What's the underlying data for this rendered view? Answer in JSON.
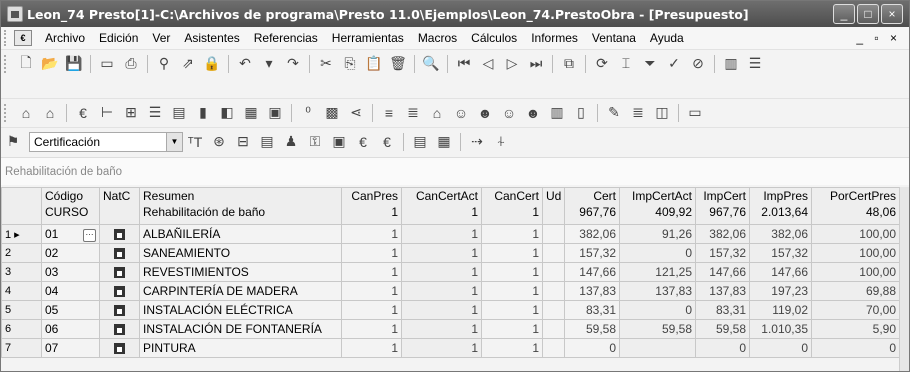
{
  "window": {
    "title": "Leon_74 Presto[1]-C:\\Archivos de programa\\Presto 11.0\\Ejemplos\\Leon_74.PrestoObra - [Presupuesto]",
    "controls": [
      "_",
      "□",
      "×"
    ]
  },
  "menu": {
    "items": [
      "Archivo",
      "Edición",
      "Ver",
      "Asistentes",
      "Referencias",
      "Herramientas",
      "Macros",
      "Cálculos",
      "Informes",
      "Ventana",
      "Ayuda"
    ],
    "mdi_controls": "_ ▫ ×"
  },
  "certbar": {
    "selected": "Certificación"
  },
  "breadcrumb": "Rehabilitación de baño",
  "grid": {
    "headers": {
      "codigo": "Código",
      "codigo_sub": "CURSO",
      "natc": "NatC",
      "resumen": "Resumen",
      "resumen_sub": "Rehabilitación de baño",
      "canpres": "CanPres",
      "canpres_sub": "1",
      "cancertact": "CanCertAct",
      "cancertact_sub": "1",
      "cancert": "CanCert",
      "cancert_sub": "1",
      "ud": "Ud",
      "cert": "Cert",
      "cert_sub": "967,76",
      "impcertact": "ImpCertAct",
      "impcertact_sub": "409,92",
      "impcert": "ImpCert",
      "impcert_sub": "967,76",
      "imppres": "ImpPres",
      "imppres_sub": "2.013,64",
      "porcertpres": "PorCertPres",
      "porcertpres_sub": "48,06"
    },
    "rows": [
      {
        "n": "1 ▸",
        "codigo": "01",
        "resumen": "ALBAÑILERÍA",
        "canpres": "1",
        "cancertact": "1",
        "cancert": "1",
        "ud": "",
        "cert": "382,06",
        "impcertact": "91,26",
        "impcert": "382,06",
        "imppres": "382,06",
        "porcertpres": "100,00"
      },
      {
        "n": "2",
        "codigo": "02",
        "resumen": "SANEAMIENTO",
        "canpres": "1",
        "cancertact": "1",
        "cancert": "1",
        "ud": "",
        "cert": "157,32",
        "impcertact": "0",
        "impcert": "157,32",
        "imppres": "157,32",
        "porcertpres": "100,00"
      },
      {
        "n": "3",
        "codigo": "03",
        "resumen": "REVESTIMIENTOS",
        "canpres": "1",
        "cancertact": "1",
        "cancert": "1",
        "ud": "",
        "cert": "147,66",
        "impcertact": "121,25",
        "impcert": "147,66",
        "imppres": "147,66",
        "porcertpres": "100,00"
      },
      {
        "n": "4",
        "codigo": "04",
        "resumen": "CARPINTERÍA DE MADERA",
        "canpres": "1",
        "cancertact": "1",
        "cancert": "1",
        "ud": "",
        "cert": "137,83",
        "impcertact": "137,83",
        "impcert": "137,83",
        "imppres": "197,23",
        "porcertpres": "69,88"
      },
      {
        "n": "5",
        "codigo": "05",
        "resumen": "INSTALACIÓN ELÉCTRICA",
        "canpres": "1",
        "cancertact": "1",
        "cancert": "1",
        "ud": "",
        "cert": "83,31",
        "impcertact": "0",
        "impcert": "83,31",
        "imppres": "119,02",
        "porcertpres": "70,00"
      },
      {
        "n": "6",
        "codigo": "06",
        "resumen": "INSTALACIÓN DE FONTANERÍA",
        "canpres": "1",
        "cancertact": "1",
        "cancert": "1",
        "ud": "",
        "cert": "59,58",
        "impcertact": "59,58",
        "impcert": "59,58",
        "imppres": "1.010,35",
        "porcertpres": "5,90"
      },
      {
        "n": "7",
        "codigo": "07",
        "resumen": "PINTURA",
        "canpres": "1",
        "cancertact": "1",
        "cancert": "1",
        "ud": "",
        "cert": "0",
        "impcertact": "",
        "impcert": "0",
        "imppres": "0",
        "porcertpres": "0"
      }
    ]
  }
}
